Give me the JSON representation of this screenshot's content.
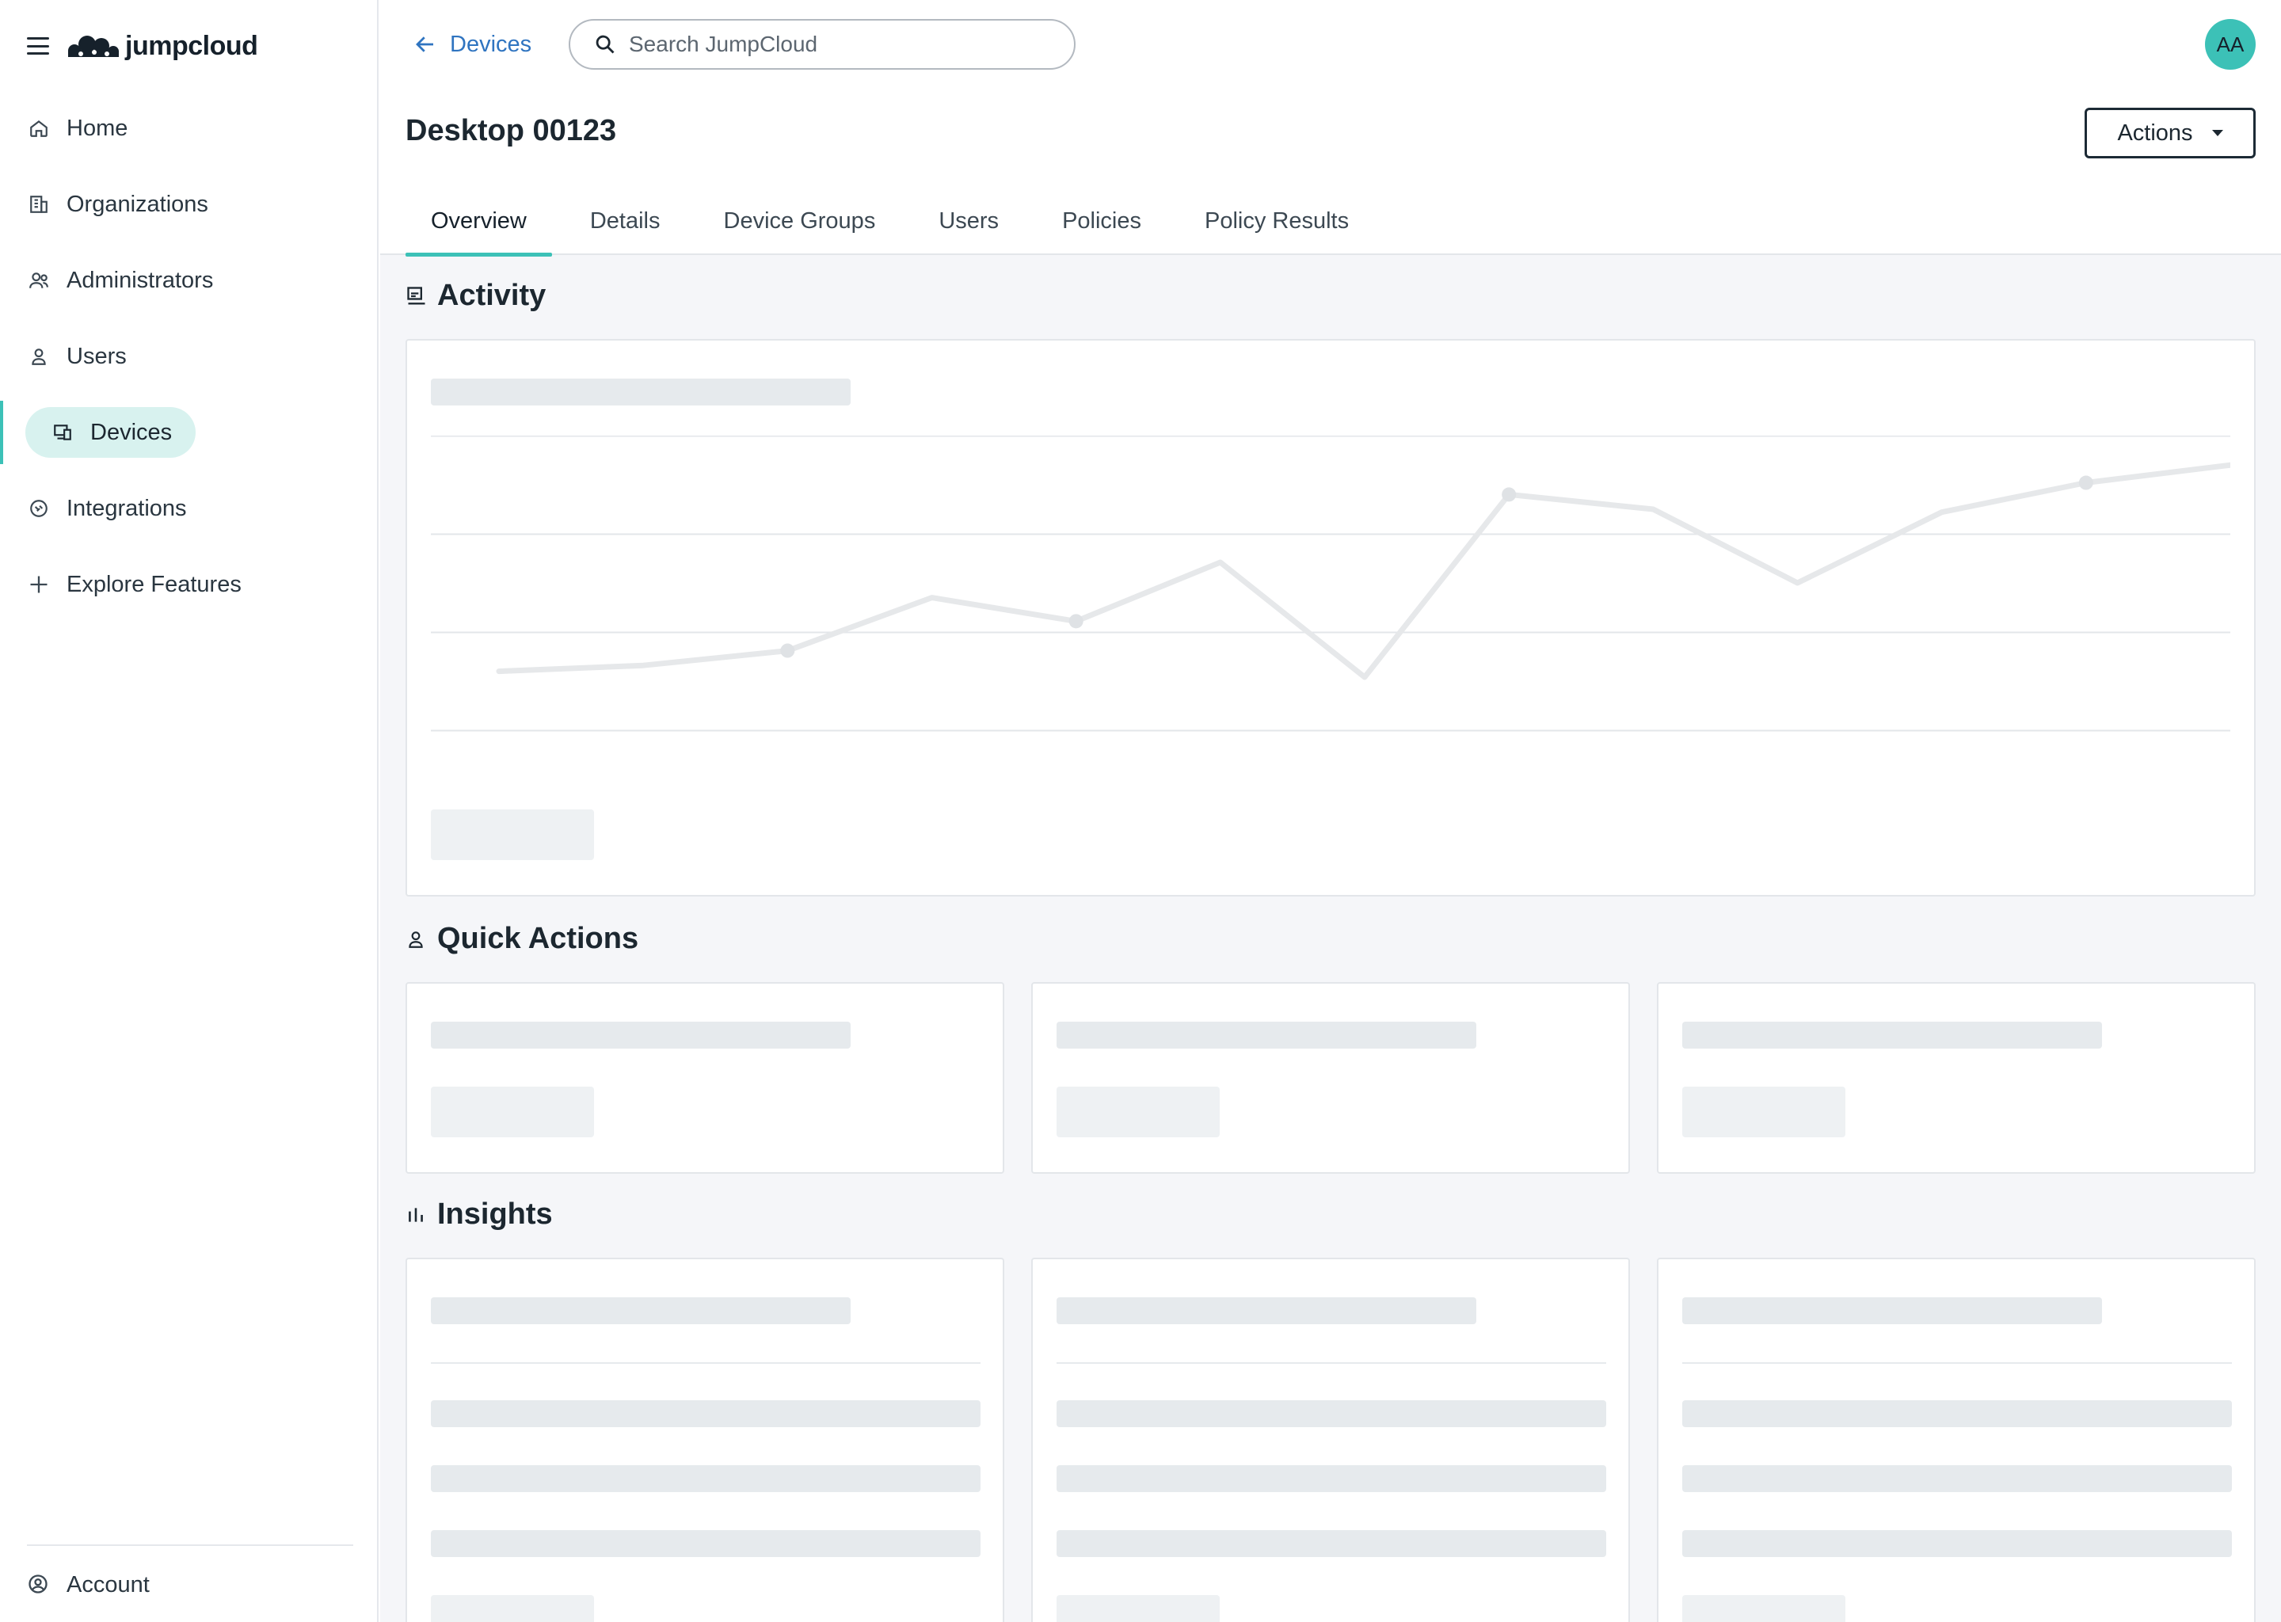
{
  "app": {
    "brand": "jumpcloud"
  },
  "sidebar": {
    "items": [
      {
        "label": "Home",
        "icon": "home-icon"
      },
      {
        "label": "Organizations",
        "icon": "building-icon"
      },
      {
        "label": "Administrators",
        "icon": "admins-icon"
      },
      {
        "label": "Users",
        "icon": "user-icon"
      },
      {
        "label": "Devices",
        "icon": "devices-icon",
        "active": true
      },
      {
        "label": "Integrations",
        "icon": "integrations-icon"
      },
      {
        "label": "Explore Features",
        "icon": "plus-icon"
      }
    ],
    "account": {
      "label": "Account",
      "icon": "account-icon"
    }
  },
  "header": {
    "back_label": "Devices",
    "search_placeholder": "Search JumpCloud",
    "avatar_initials": "AA",
    "title": "Desktop 00123",
    "actions_label": "Actions",
    "tabs": [
      "Overview",
      "Details",
      "Device Groups",
      "Users",
      "Policies",
      "Policy Results"
    ],
    "active_tab": "Overview"
  },
  "sections": {
    "activity": {
      "title": "Activity",
      "icon": "activity-icon"
    },
    "quick_actions": {
      "title": "Quick Actions",
      "icon": "user-icon"
    },
    "insights": {
      "title": "Insights",
      "icon": "bar-chart-icon"
    }
  },
  "colors": {
    "accent": "#3cc1b7",
    "accent_light": "#d8f2ef",
    "link": "#2f74c0",
    "skeleton": "#e6eaed"
  },
  "chart_data": {
    "type": "line",
    "x": [
      0,
      1,
      2,
      3,
      4,
      5,
      6,
      7,
      8,
      9,
      10,
      11,
      12
    ],
    "values": [
      20,
      22,
      27,
      45,
      37,
      57,
      18,
      80,
      75,
      50,
      74,
      84,
      90
    ],
    "ylim": [
      0,
      100
    ],
    "grid": true,
    "markers_at": [
      2,
      4,
      7,
      11
    ]
  }
}
